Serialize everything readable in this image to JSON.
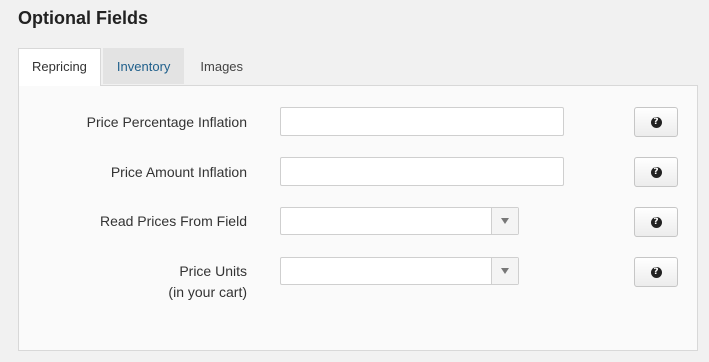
{
  "section": {
    "title": "Optional Fields"
  },
  "tabs": [
    {
      "label": "Repricing",
      "active": true
    },
    {
      "label": "Inventory",
      "active": false
    },
    {
      "label": "Images",
      "active": false
    }
  ],
  "fields": [
    {
      "label": "Price Percentage Inflation",
      "type": "text",
      "value": "",
      "help_icon": "question-circle-icon"
    },
    {
      "label": "Price Amount Inflation",
      "type": "text",
      "value": "",
      "help_icon": "question-circle-icon"
    },
    {
      "label": "Read Prices From Field",
      "type": "select",
      "value": "",
      "help_icon": "question-circle-icon"
    },
    {
      "label": "Price Units",
      "sublabel": "(in your cart)",
      "type": "select",
      "value": "",
      "help_icon": "question-circle-icon"
    }
  ],
  "help_glyph": "?",
  "colors": {
    "inventory_tab_text": "#1f5f8b",
    "panel_bg": "#fafafa",
    "page_bg": "#f1f1f1"
  }
}
